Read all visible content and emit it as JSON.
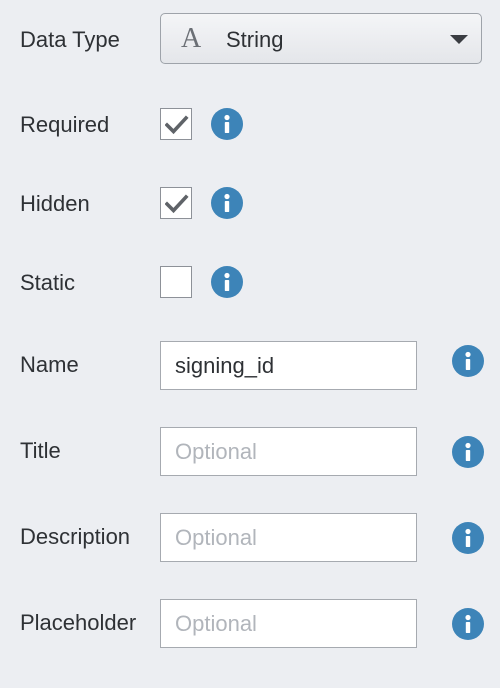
{
  "data_type": {
    "label": "Data Type",
    "type_icon": "A",
    "value": "String"
  },
  "flags": [
    {
      "label": "Required",
      "checked": true
    },
    {
      "label": "Hidden",
      "checked": true
    },
    {
      "label": "Static",
      "checked": false
    }
  ],
  "fields": {
    "name": {
      "label": "Name",
      "value": "signing_id",
      "placeholder": ""
    },
    "title": {
      "label": "Title",
      "value": "",
      "placeholder": "Optional"
    },
    "description": {
      "label": "Description",
      "value": "",
      "placeholder": "Optional"
    },
    "placeholder": {
      "label": "Placeholder",
      "value": "",
      "placeholder": "Optional"
    }
  },
  "icons": {
    "info": "info-icon",
    "check": "checkmark-icon",
    "caret": "chevron-down-icon",
    "type": "string-type-icon"
  },
  "colors": {
    "info_blue": "#3d84b8",
    "background": "#eceef2"
  }
}
